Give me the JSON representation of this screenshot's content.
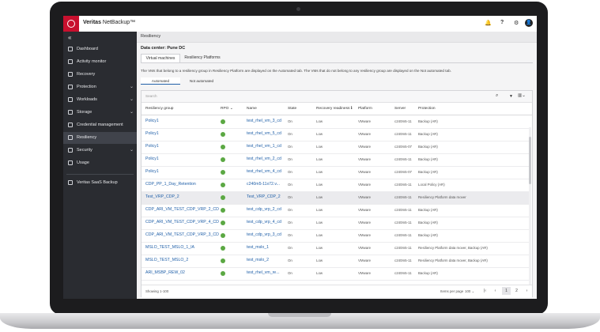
{
  "app": {
    "brand_bold": "Veritas",
    "brand_rest": " NetBackup™"
  },
  "topbar_icons": [
    "bell-icon",
    "help-icon",
    "gear-icon",
    "user-icon"
  ],
  "topbar_glyphs": {
    "bell": "🔔",
    "help": "?",
    "gear": "⚙",
    "avatar": "👤"
  },
  "sidebar": {
    "collapse_glyph": "«",
    "items": [
      {
        "label": "Dashboard",
        "chevron": ""
      },
      {
        "label": "Activity monitor",
        "chevron": ""
      },
      {
        "label": "Recovery",
        "chevron": ""
      },
      {
        "label": "Protection",
        "chevron": "⌄"
      },
      {
        "label": "Workloads",
        "chevron": "⌄"
      },
      {
        "label": "Storage",
        "chevron": "⌄"
      },
      {
        "label": "Credential management",
        "chevron": ""
      },
      {
        "label": "Resiliency",
        "chevron": ""
      },
      {
        "label": "Security",
        "chevron": "⌄"
      },
      {
        "label": "Usage",
        "chevron": ""
      },
      {
        "label": "Veritas SaaS Backup",
        "chevron": ""
      }
    ]
  },
  "main": {
    "breadcrumb": "Resiliency",
    "datacenter_title": "Data center: Pune DC",
    "tabs": [
      "Virtual machines",
      "Resiliency Platforms"
    ],
    "description": "The VMs that belong to a resiliency group in Resiliency Platform are displayed on the Automated tab. The VMs that do not belong to any resiliency group are displayed on the Not automated tab.",
    "segments": [
      "Automated",
      "Not automated"
    ],
    "search_placeholder": "Search",
    "toolbar_glyphs": {
      "search": "⌕",
      "filter": "▼",
      "columns": "▥⌄"
    },
    "columns": [
      "Resiliency group",
      "RPO",
      "Name",
      "State",
      "Recovery readiness",
      "Platform",
      "Server",
      "Protection"
    ],
    "sort_glyph": "⌄",
    "info_glyph": "ℹ",
    "rows": [
      {
        "group": "Policy1",
        "name": "test_rhel_vm_3_cd",
        "state": "On",
        "readiness": "Low",
        "platform": "VMware",
        "server": "c240m5-11",
        "protection": "Backup (AR)",
        "highlight": false
      },
      {
        "group": "Policy1",
        "name": "test_rhel_vm_5_cd",
        "state": "On",
        "readiness": "Low",
        "platform": "VMware",
        "server": "c240m5-11",
        "protection": "Backup (AR)",
        "highlight": false
      },
      {
        "group": "Policy1",
        "name": "test_rhel_vm_1_cd",
        "state": "On",
        "readiness": "Low",
        "platform": "VMware",
        "server": "c240m5-07",
        "protection": "Backup (AR)",
        "highlight": false
      },
      {
        "group": "Policy1",
        "name": "test_rhel_vm_2_cd",
        "state": "On",
        "readiness": "Low",
        "platform": "VMware",
        "server": "c240m5-11",
        "protection": "Backup (AR)",
        "highlight": false
      },
      {
        "group": "Policy1",
        "name": "test_rhel_vm_4_cd",
        "state": "On",
        "readiness": "Low",
        "platform": "VMware",
        "server": "c240m5-07",
        "protection": "Backup (AR)",
        "highlight": false
      },
      {
        "group": "CDP_PP_1_Day_Retention",
        "name": "c240m5-11x72.v...",
        "state": "On",
        "readiness": "Low",
        "platform": "VMware",
        "server": "c240m5-11",
        "protection": "Local Policy (AR)",
        "highlight": false
      },
      {
        "group": "Test_VRP_CDP_2",
        "name": "Test_VRP_CDP_2",
        "state": "On",
        "readiness": "Low",
        "platform": "VMware",
        "server": "c240m5-11",
        "protection": "Resiliency Platform data mover",
        "highlight": true
      },
      {
        "group": "CDP_ARI_VM_TEST_CDP_VRP_2_CD",
        "name": "test_cdp_vrp_2_cd",
        "state": "On",
        "readiness": "Low",
        "platform": "VMware",
        "server": "c240m5-11",
        "protection": "Backup (AR)",
        "highlight": false
      },
      {
        "group": "CDP_ARI_VM_TEST_CDP_VRP_4_CD",
        "name": "test_cdp_vrp_4_cd",
        "state": "On",
        "readiness": "Low",
        "platform": "VMware",
        "server": "c240m5-11",
        "protection": "Backup (AR)",
        "highlight": false
      },
      {
        "group": "CDP_ARI_VM_TEST_CDP_VRP_3_CD",
        "name": "test_cdp_vrp_3_cd",
        "state": "On",
        "readiness": "Low",
        "platform": "VMware",
        "server": "c240m5-11",
        "protection": "Backup (AR)",
        "highlight": false
      },
      {
        "group": "MSLO_TEST_MSLO_1_IA",
        "name": "test_mslo_1",
        "state": "On",
        "readiness": "Low",
        "platform": "VMware",
        "server": "c240m5-11",
        "protection": "Resiliency Platform data mover, Backup (AR)",
        "highlight": false
      },
      {
        "group": "MSLO_TEST_MSLO_2",
        "name": "test_mslo_2",
        "state": "On",
        "readiness": "Low",
        "platform": "VMware",
        "server": "c240m5-11",
        "protection": "Resiliency Platform data mover, Backup (AR)",
        "highlight": false
      },
      {
        "group": "ARI_MSBP_REW_02",
        "name": "test_rhel_vm_re...",
        "state": "On",
        "readiness": "Low",
        "platform": "VMware",
        "server": "c240m5-11",
        "protection": "Backup (AR)",
        "highlight": false
      }
    ],
    "footer": {
      "showing": "Showing 1-100",
      "items_per_page_label": "Items per page",
      "items_per_page_value": "100 ⌄",
      "pages": [
        "|‹",
        "‹",
        "1",
        "2",
        "›"
      ]
    }
  }
}
